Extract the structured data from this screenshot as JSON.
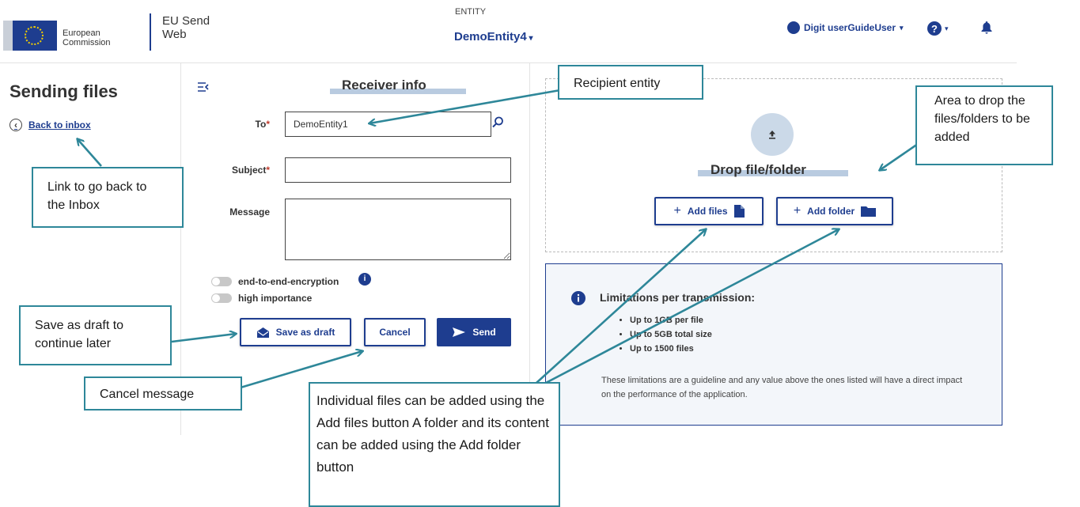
{
  "header": {
    "logo_line1": "European",
    "logo_line2": "Commission",
    "app_name_line1": "EU Send",
    "app_name_line2": "Web",
    "entity_label": "ENTITY",
    "entity_name": "DemoEntity4",
    "user_name": "Digit userGuideUser",
    "help_label": "?"
  },
  "sidebar": {
    "title": "Sending files",
    "back_link": "Back to inbox"
  },
  "form": {
    "section_title": "Receiver info",
    "to_label": "To",
    "to_value": "DemoEntity1",
    "subject_label": "Subject",
    "subject_value": "",
    "message_label": "Message",
    "message_value": "",
    "required_mark": "*",
    "toggle_encryption": "end-to-end-encryption",
    "toggle_importance": "high importance",
    "info_mark": "i",
    "save_draft": "Save as draft",
    "cancel": "Cancel",
    "send": "Send"
  },
  "drop": {
    "title": "Drop file/folder",
    "add_files": "Add files",
    "add_folder": "Add folder"
  },
  "limits": {
    "title": "Limitations per transmission:",
    "items": [
      "Up to 1GB per file",
      "Up to 5GB total size",
      "Up to 1500 files"
    ],
    "note": "These limitations are a guideline and any value above the ones listed will have a direct impact on the performance of the application."
  },
  "callouts": {
    "recipient": "Recipient entity",
    "drop_area": "Area to drop the files/folders to be added",
    "back_link": "Link to go back to the Inbox",
    "save_draft": "Save as draft to continue later",
    "cancel": "Cancel message",
    "add_buttons": "Individual files can be added using the Add files button A folder and its content can be added using the Add folder button"
  },
  "colors": {
    "brand": "#1e3d8f",
    "callout_border": "#2e8799",
    "highlight": "#b9cbe0"
  }
}
